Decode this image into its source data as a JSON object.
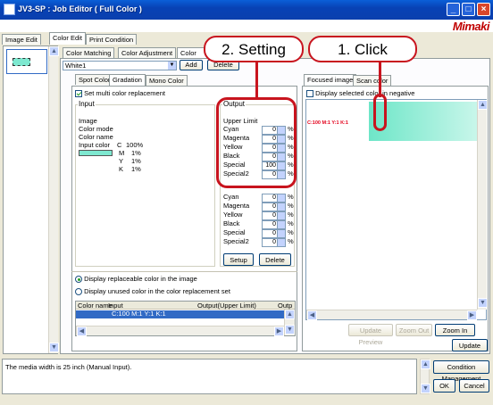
{
  "window": {
    "title": "JV3-SP : Job Editor ( Full Color )",
    "logo": "Mimaki",
    "min": "_",
    "max": "□",
    "close": "×"
  },
  "top_tabs": [
    "Image Edit",
    "Color Edit",
    "Print Condition"
  ],
  "color_tabs": [
    "Color Matching",
    "Color Adjustment",
    "Color"
  ],
  "color_set": {
    "value": "White1",
    "add": "Add",
    "delete": "Delete"
  },
  "sub_tabs": [
    "Spot Color",
    "Gradation",
    "Mono Color"
  ],
  "set_multi": "Set multi color replacement",
  "input": {
    "title": "Input",
    "image": "Image",
    "color_mode": "Color mode",
    "color_name": "Color name",
    "input_color": "Input color",
    "values": [
      {
        "ch": "C",
        "v": "100%"
      },
      {
        "ch": "M",
        "v": "1%"
      },
      {
        "ch": "Y",
        "v": "1%"
      },
      {
        "ch": "K",
        "v": "1%"
      }
    ]
  },
  "output": {
    "title": "Output",
    "upper_limit": "Upper Limit",
    "upper": [
      {
        "name": "Cyan",
        "v": "0"
      },
      {
        "name": "Magenta",
        "v": "0"
      },
      {
        "name": "Yellow",
        "v": "0"
      },
      {
        "name": "Black",
        "v": "0"
      },
      {
        "name": "Special",
        "v": "100"
      },
      {
        "name": "Special2",
        "v": "0"
      }
    ],
    "lower": [
      {
        "name": "Cyan",
        "v": "0"
      },
      {
        "name": "Magenta",
        "v": "0"
      },
      {
        "name": "Yellow",
        "v": "0"
      },
      {
        "name": "Black",
        "v": "0"
      },
      {
        "name": "Special",
        "v": "0"
      },
      {
        "name": "Special2",
        "v": "0"
      }
    ],
    "pct": "%",
    "setup": "Setup",
    "delete": "Delete"
  },
  "display_opts": [
    "Display replaceable color in the image",
    "Display unused color in the color replacement set"
  ],
  "list": {
    "headers": [
      "Color name",
      "Input",
      "Output(Upper Limit)",
      "Outp"
    ],
    "rows": [
      {
        "input": "C:100 M:1 Y:1 K:1"
      }
    ]
  },
  "preview": {
    "tabs": [
      "Focused image",
      "Scan color"
    ],
    "negative": "Display selected color in negative",
    "label": "C:100  M:1  Y:1  K:1",
    "update_preview": "Update Preview",
    "zoom_out": "Zoom Out",
    "zoom_in": "Zoom In",
    "update": "Update",
    "colors": {
      "swatch": "#7ee8d0"
    }
  },
  "status": {
    "message": "The media width is 25 inch (Manual Input).",
    "condition": "Condition Management",
    "ok": "OK",
    "cancel": "Cancel"
  },
  "callouts": {
    "setting": "2. Setting",
    "click": "1. Click"
  }
}
